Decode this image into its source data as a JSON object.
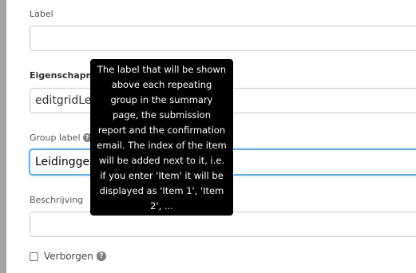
{
  "form": {
    "label_field": {
      "label": "Label",
      "value": ""
    },
    "property_name_field": {
      "label": "Eigenschapna",
      "value": "editgridLei"
    },
    "group_label_field": {
      "label": "Group label",
      "value": "Leidinggev",
      "help_icon": "question-circle-icon"
    },
    "description_field": {
      "label": "Beschrijving",
      "value": ""
    },
    "hidden_checkbox": {
      "label": "Verborgen",
      "checked": false,
      "help_icon": "question-circle-icon"
    }
  },
  "tooltip": {
    "lines": [
      "The label that will be shown",
      "above each repeating",
      "group in the summary",
      "page, the submission",
      "report and the confirmation",
      "email. The index of the item",
      "will be added next to it, i.e.",
      "if you enter 'Item' it will be",
      "displayed as 'Item 1', 'Item",
      "2', ..."
    ]
  },
  "colors": {
    "tooltip_bg": "#000000",
    "focus_border": "#66afe9",
    "input_border": "#cccccc",
    "left_bar": "#a3a3a3"
  }
}
